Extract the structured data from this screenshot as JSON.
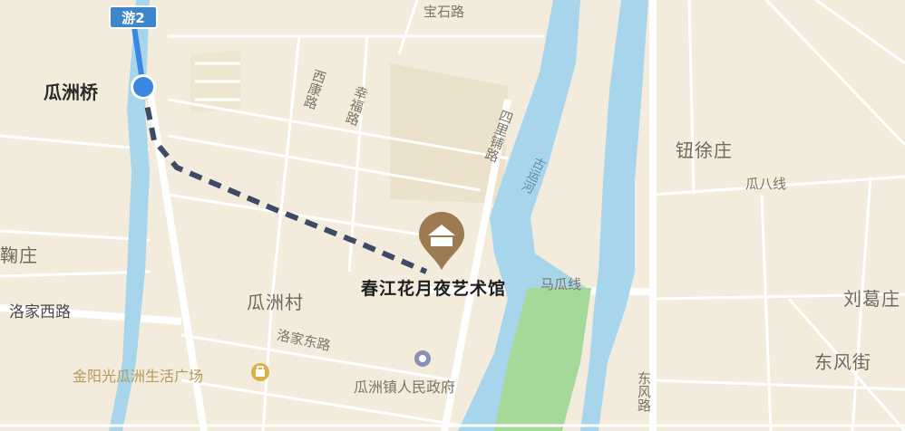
{
  "route_shield": "游2",
  "start_label": "瓜洲桥",
  "destination": "春江花月夜艺术馆",
  "places": {
    "niuxu": "钮徐庄",
    "liuge": "刘葛庄",
    "dongfeng": "东风街",
    "guazhou_village": "瓜洲村",
    "juzhuang": "鞠庄"
  },
  "roads": {
    "baoshi": "宝石路",
    "xikang": "西康路",
    "xingfu": "幸福路",
    "sili": "四里铺路",
    "guaba": "瓜八线",
    "magua": "马瓜线",
    "luojia_west": "洛家西路",
    "luojia_east": "洛家东路",
    "dongfeng_road": "东风路"
  },
  "river": "古运河",
  "pois": {
    "mall": "金阳光瓜洲生活广场",
    "gov": "瓜洲镇人民政府"
  },
  "colors": {
    "land": "#f3ecdd",
    "water": "#a7d6ec",
    "park": "#a4d99a",
    "route_walk": "#3f4a66",
    "route_start": "#3a86e0",
    "shield": "#3d86c9",
    "poi_pin": "#9c7a52"
  },
  "icons": {
    "start": "start-location-icon",
    "destination": "museum-pin-icon",
    "gov": "government-icon",
    "mall": "shopping-icon"
  }
}
